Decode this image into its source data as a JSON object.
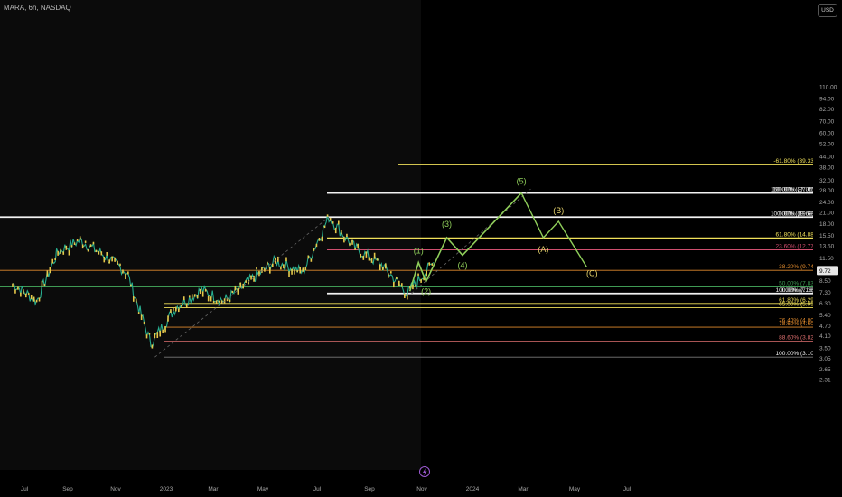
{
  "header": {
    "title": "MARA, 6h, NASDAQ",
    "currency": "USD"
  },
  "colors": {
    "background": "#000000",
    "plot_background": "#0b0b0b",
    "price_line": "#27ae8f",
    "price_dots": "#e6c84a",
    "elliott_impulse": "#8fce5a",
    "elliott_corrective": "#e6d36b",
    "fib_white": "#f2f2f2",
    "fib_yellow": "#f0e05a",
    "fib_orange": "#e08a2d",
    "fib_pink": "#d04f6f",
    "fib_red": "#e07070",
    "fib_green": "#3f9a54",
    "fib_gray": "#7a7a7a"
  },
  "chart_data": {
    "type": "line",
    "symbol": "MARA",
    "interval": "6h",
    "exchange": "NASDAQ",
    "currency": "USD",
    "log_scale": true,
    "ylim": [
      2.2,
      140
    ],
    "grid": false,
    "y_ticks": [
      "110.00",
      "94.00",
      "82.00",
      "70.00",
      "60.00",
      "52.00",
      "44.00",
      "38.00",
      "32.00",
      "28.00",
      "24.00",
      "21.00",
      "18.00",
      "15.50",
      "13.50",
      "11.50",
      "9.72",
      "8.50",
      "7.30",
      "6.30",
      "5.40",
      "4.70",
      "4.10",
      "3.50",
      "3.05",
      "2.65",
      "2.31"
    ],
    "current_price": 9.72,
    "x_ticks": [
      "Jul",
      "Sep",
      "Nov",
      "2023",
      "Mar",
      "May",
      "Jul",
      "Sep",
      "Nov",
      "2024",
      "Mar",
      "May",
      "Jul"
    ],
    "price_series": {
      "x": [
        "2022-06",
        "2022-07",
        "2022-08",
        "2022-09",
        "2022-10",
        "2022-11",
        "2022-12",
        "2023-01",
        "2023-02",
        "2023-03",
        "2023-04",
        "2023-05",
        "2023-06",
        "2023-07",
        "2023-08",
        "2023-09",
        "2023-10",
        "2023-11"
      ],
      "y": [
        8.2,
        6.5,
        12.5,
        14.5,
        12.0,
        9.5,
        3.7,
        6.0,
        7.5,
        6.5,
        8.5,
        11.0,
        9.5,
        19.7,
        13.0,
        10.5,
        7.2,
        10.8
      ]
    },
    "elliott_projection": {
      "impulse": [
        {
          "label": "(1)",
          "x": "2023-10-28",
          "y": 10.8
        },
        {
          "label": "(2)",
          "x": "2023-11-06",
          "y": 8.4
        },
        {
          "label": "(3)",
          "x": "2023-12-01",
          "y": 15.0
        },
        {
          "label": "(4)",
          "x": "2023-12-20",
          "y": 11.9
        },
        {
          "label": "(5)",
          "x": "2024-02-28",
          "y": 27.05
        }
      ],
      "corrective": [
        {
          "label": "(A)",
          "x": "2024-03-25",
          "y": 15.0
        },
        {
          "label": "(B)",
          "x": "2024-04-12",
          "y": 18.6
        },
        {
          "label": "(C)",
          "x": "2024-05-15",
          "y": 10.2
        }
      ]
    },
    "fib_sets": [
      {
        "name": "upper",
        "levels": [
          {
            "label": "-61.80% (39.33)",
            "value": 39.33
          },
          {
            "label": "100.00% (27.05)",
            "value": 27.05
          },
          {
            "label": "160.00% (27.05)",
            "value": 27.05
          },
          {
            "label": "0.00% (19.68)",
            "value": 19.68
          },
          {
            "label": "100.00% (19.68)",
            "value": 19.68
          },
          {
            "label": "61.80% (14.88)",
            "value": 14.88
          },
          {
            "label": "23.60% (12.77)",
            "value": 12.77
          },
          {
            "label": "38.20% (9.74)",
            "value": 9.74
          },
          {
            "label": "50.00% (7.83)",
            "value": 7.83
          },
          {
            "label": "100.00% (7.18)",
            "value": 7.18
          },
          {
            "label": "0.00% (7.18)",
            "value": 7.18
          }
        ]
      },
      {
        "name": "lower",
        "levels": [
          {
            "label": "61.80% (6.29)",
            "value": 6.29
          },
          {
            "label": "65.00% (5.95)",
            "value": 5.95
          },
          {
            "label": "76.40% (4.80)",
            "value": 4.8
          },
          {
            "label": "78.60% (4.60)",
            "value": 4.6
          },
          {
            "label": "88.60% (3.82)",
            "value": 3.82
          },
          {
            "label": "100.00% (3.10)",
            "value": 3.1
          }
        ]
      }
    ]
  }
}
